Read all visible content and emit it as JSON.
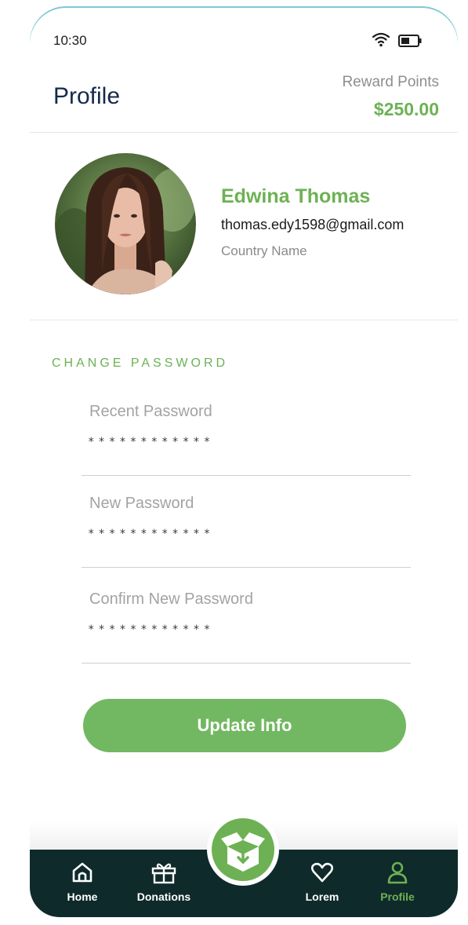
{
  "status_bar": {
    "time": "10:30"
  },
  "header": {
    "title": "Profile",
    "reward_label": "Reward Points",
    "reward_value": "$250.00"
  },
  "profile": {
    "name": "Edwina Thomas",
    "email": "thomas.edy1598@gmail.com",
    "country": "Country Name"
  },
  "change_password": {
    "section_title": "CHANGE PASSWORD",
    "fields": [
      {
        "label": "Recent Password",
        "value": "************"
      },
      {
        "label": "New Password",
        "value": "************"
      },
      {
        "label": "Confirm New Password",
        "value": "************"
      }
    ],
    "button_label": "Update Info"
  },
  "tab_bar": {
    "items": [
      {
        "label": "Home",
        "icon": "home-icon"
      },
      {
        "label": "Donations",
        "icon": "gift-icon"
      },
      {
        "label": "Lorem",
        "icon": "heart-icon"
      },
      {
        "label": "Profile",
        "icon": "user-icon"
      }
    ],
    "active": "Profile",
    "center_icon": "open-box-icon"
  },
  "colors": {
    "accent": "#6db154",
    "title": "#152a4a",
    "tab_bar_bg": "#0f2a2a"
  }
}
